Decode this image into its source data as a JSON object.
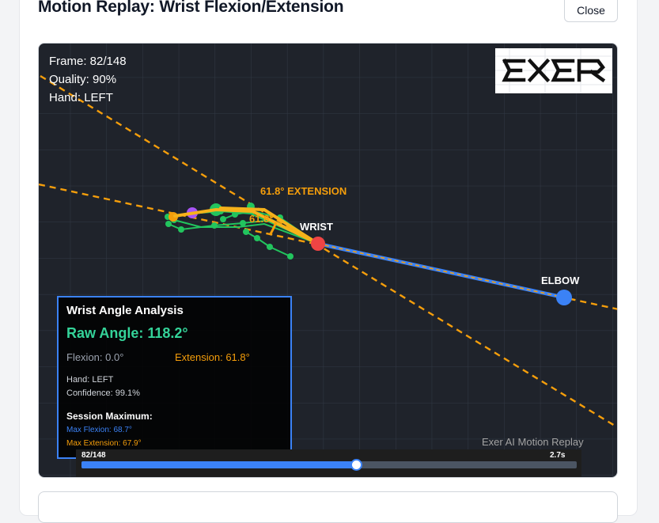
{
  "modal": {
    "title": "Motion Replay: Wrist Flexion/Extension",
    "close_label": "Close"
  },
  "hud": {
    "frame": "Frame: 82/148",
    "quality": "Quality: 90%",
    "hand": "Hand: LEFT"
  },
  "logo": {
    "text": "EXER"
  },
  "skeleton": {
    "wrist_label": "WRIST",
    "elbow_label": "ELBOW",
    "angle_label": "61.8° EXTENSION",
    "arc_label": "61.8°"
  },
  "analysis": {
    "title": "Wrist Angle Analysis",
    "raw_angle": "Raw Angle: 118.2°",
    "flexion": "Flexion: 0.0°",
    "extension": "Extension: 61.8°",
    "hand": "Hand: LEFT",
    "confidence": "Confidence: 99.1%",
    "session_title": "Session Maximum:",
    "max_flexion": "Max Flexion: 68.7°",
    "max_extension": "Max Extension: 67.9°"
  },
  "watermark": "Exer AI Motion Replay",
  "timeline": {
    "frame_label": "82/148",
    "time_label": "2.7s",
    "progress": 0.554
  },
  "colors": {
    "accent": "#3b82f6",
    "extension": "#f59e0b",
    "flexion_green": "#22c55e",
    "wrist": "#ef4444",
    "grid": "#2f3542",
    "stage_bg": "#1f232b"
  }
}
